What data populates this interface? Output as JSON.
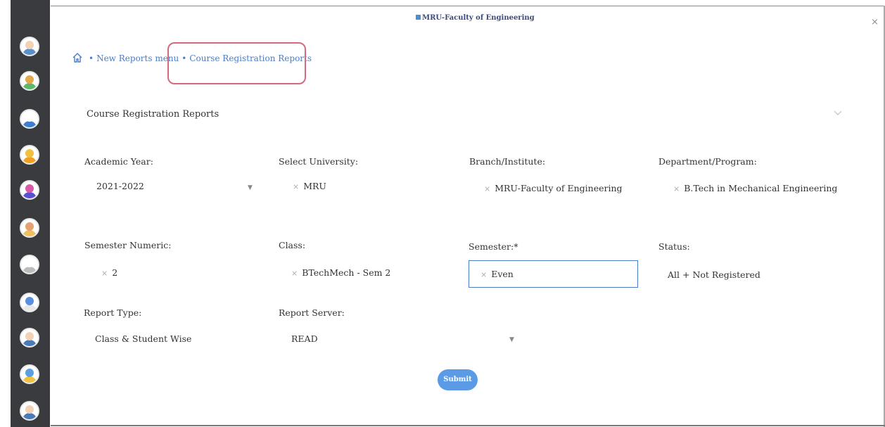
{
  "window": {
    "title": "MRU-Faculty of Engineering",
    "dot": "·",
    "close": "×"
  },
  "breadcrumb": {
    "separator": "•",
    "items": [
      "New Reports menu",
      "Course Registration Reports"
    ]
  },
  "card": {
    "title": "Course Registration Reports"
  },
  "fields": {
    "academic_year": {
      "label": "Academic Year:",
      "value": "2021-2022"
    },
    "university": {
      "label": "Select University:",
      "value": "MRU"
    },
    "branch": {
      "label": "Branch/Institute:",
      "value": "MRU-Faculty of Engineering"
    },
    "department": {
      "label": "Department/Program:",
      "value": "B.Tech in Mechanical Engineering"
    },
    "semester_numeric": {
      "label": "Semester Numeric:",
      "value": "2"
    },
    "class": {
      "label": "Class:",
      "value": "BTechMech - Sem 2"
    },
    "semester": {
      "label": "Semester:*",
      "value": "Even"
    },
    "status": {
      "label": "Status:",
      "value": "All + Not Registered"
    },
    "report_type": {
      "label": "Report Type:",
      "value": "Class & Student Wise"
    },
    "report_server": {
      "label": "Report Server:",
      "value": "READ"
    }
  },
  "clear_icon": "×",
  "dropdown_caret": "▼",
  "submit_label": "Submit",
  "sidebar": {
    "avatars": [
      {
        "icon": "avatar-icon",
        "face": "#f2d2b6",
        "body": "#5b8fc7"
      },
      {
        "icon": "avatar-icon",
        "face": "#e3a84a",
        "body": "#5cb86b"
      },
      {
        "icon": "avatar-icon",
        "face": "#ffffff",
        "body": "#3c7fd0"
      },
      {
        "icon": "avatar-icon",
        "face": "#f0c040",
        "body": "#f0a020"
      },
      {
        "icon": "avatar-icon",
        "face": "#d65aa8",
        "body": "#5b4fd0"
      },
      {
        "icon": "avatar-icon",
        "face": "#e7a070",
        "body": "#f0c060"
      },
      {
        "icon": "avatar-icon",
        "face": "#ffffff",
        "body": "#bbbbbb"
      },
      {
        "icon": "avatar-icon",
        "face": "#5a8fe0",
        "body": "#e8e8e8"
      },
      {
        "icon": "avatar-icon",
        "face": "#f2d2b6",
        "body": "#4a7ab8"
      },
      {
        "icon": "avatar-icon",
        "face": "#5aa0e0",
        "body": "#f0c040"
      },
      {
        "icon": "avatar-icon",
        "face": "#f2d2b6",
        "body": "#4a7ab8"
      }
    ]
  },
  "colors": {
    "accent": "#4a7dc9",
    "highlight": "#d46a7d",
    "button": "#5b9be6",
    "sidebar": "#3a3b3e"
  }
}
